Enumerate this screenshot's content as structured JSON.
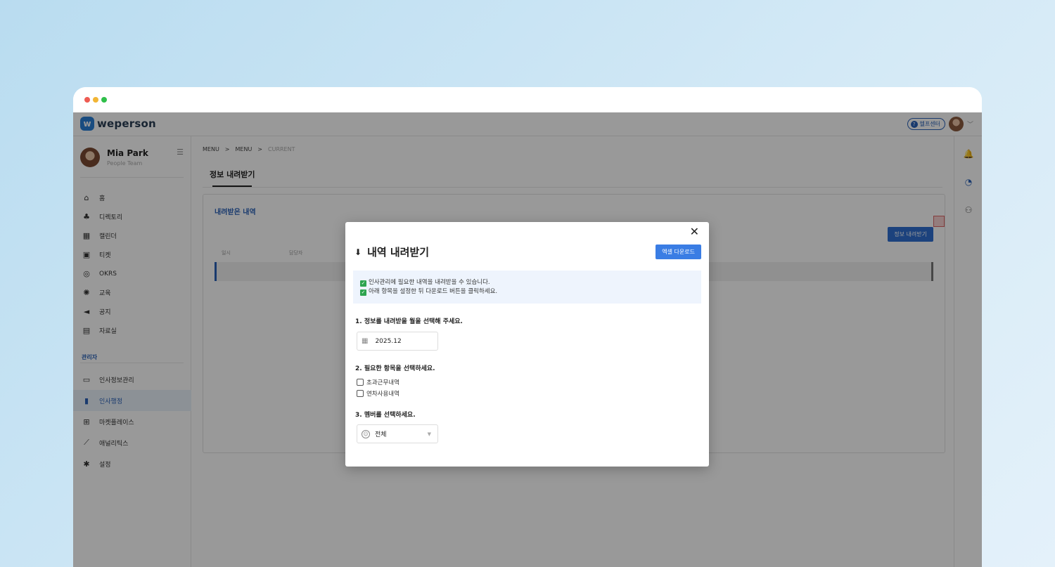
{
  "app": {
    "logo_letter": "w",
    "logo_text": "weperson",
    "help_label": "헬프센터"
  },
  "profile": {
    "name": "Mia Park",
    "team": "People Team"
  },
  "sidebar": {
    "items": [
      {
        "label": "홈",
        "icon": "home-icon",
        "glyph": "⌂"
      },
      {
        "label": "디렉토리",
        "icon": "org-chart-icon",
        "glyph": "♣"
      },
      {
        "label": "캘린더",
        "icon": "calendar-icon",
        "glyph": "▦"
      },
      {
        "label": "티켓",
        "icon": "ticket-icon",
        "glyph": "▣"
      },
      {
        "label": "OKRS",
        "icon": "target-icon",
        "glyph": "◎"
      },
      {
        "label": "교육",
        "icon": "lightbulb-icon",
        "glyph": "✺"
      },
      {
        "label": "공지",
        "icon": "megaphone-icon",
        "glyph": "◄"
      },
      {
        "label": "자료실",
        "icon": "archive-icon",
        "glyph": "▤"
      }
    ],
    "admin_label": "관리자",
    "admin_items": [
      {
        "label": "인사정보관리",
        "icon": "folder-icon",
        "glyph": "▭"
      },
      {
        "label": "인사행정",
        "icon": "document-icon",
        "glyph": "▮"
      },
      {
        "label": "마켓플레이스",
        "icon": "gift-icon",
        "glyph": "⊞"
      },
      {
        "label": "애널리틱스",
        "icon": "chart-icon",
        "glyph": "⟋"
      },
      {
        "label": "설정",
        "icon": "gear-icon",
        "glyph": "✱"
      }
    ]
  },
  "breadcrumb": {
    "first": "MENU",
    "sep": ">",
    "second": "MENU",
    "current": "CURRENT"
  },
  "page": {
    "tab": "정보 내려받기"
  },
  "card": {
    "title": "내려받은 내역",
    "button": "정보 내려받기",
    "col_date": "일시",
    "col_person": "담당자"
  },
  "modal": {
    "title": "내역 내려받기",
    "excel_button": "엑셀 다운로드",
    "notice_1": "인사관리에 필요한 내역을 내려받을 수 있습니다.",
    "notice_2": "아래 항목을 설정한 뒤 다운로드 버튼을 클릭하세요.",
    "step1": "1. 정보를 내려받을 월을 선택해 주세요.",
    "month_value": "2025.12",
    "step2": "2. 필요한 항목을 선택하세요.",
    "option_overtime": "초과근무내역",
    "option_leave": "연차사용내역",
    "step3": "3. 멤버를 선택하세요.",
    "member_value": "전체"
  }
}
